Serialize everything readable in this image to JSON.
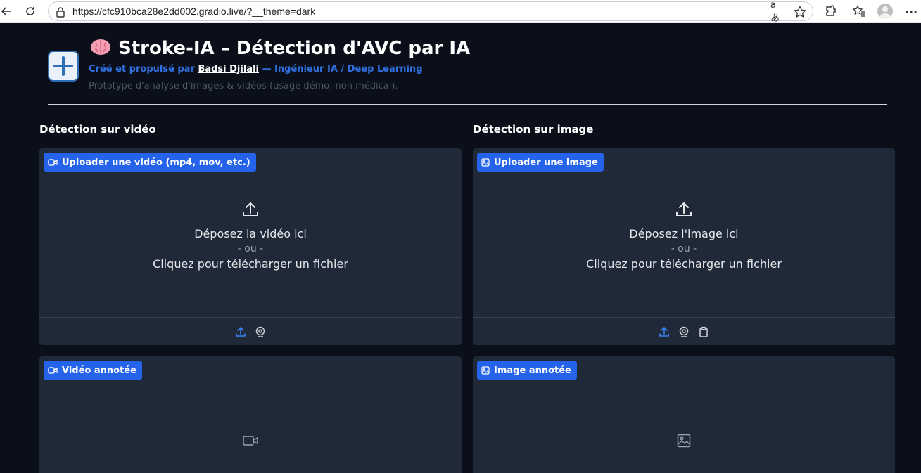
{
  "browser": {
    "url": "https://cfc910bca28e2dd002.gradio.live/?__theme=dark",
    "translate_glyph": "aあ"
  },
  "header": {
    "title": "Stroke-IA – Détection d'AVC par IA",
    "subtitle_prefix": "Créé et propulsé par ",
    "author": "Badsi Djilali",
    "subtitle_suffix": " — Ingénieur IA / Deep Learning",
    "description": "Prototype d'analyse d'images & vidéos (usage démo, non médical)."
  },
  "video_section": {
    "title": "Détection sur vidéo",
    "upload_label": "Uploader une vidéo (mp4, mov, etc.)",
    "drop_title": "Déposez la vidéo ici",
    "drop_or": "- ou -",
    "drop_click": "Cliquez pour télécharger un fichier",
    "output_label": "Vidéo annotée"
  },
  "image_section": {
    "title": "Détection sur image",
    "upload_label": "Uploader une image",
    "drop_title": "Déposez l'image ici",
    "drop_or": "- ou -",
    "drop_click": "Cliquez pour télécharger un fichier",
    "output_label": "Image annotée"
  },
  "colors": {
    "background": "#0b0f19",
    "panel": "#1f2937",
    "accent": "#2563eb",
    "subtitle": "#2f6fe0"
  }
}
